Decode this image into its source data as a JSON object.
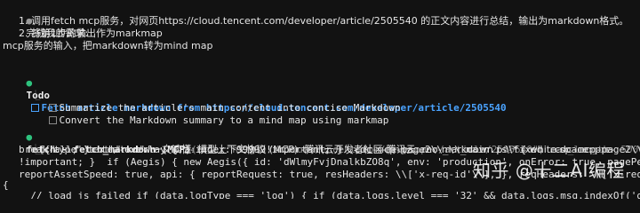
{
  "summary_block": {
    "bullet": "●",
    "title": "完成我的需求:",
    "steps": [
      "1. 调用fetch mcp服务，对网页https://cloud.tencent.com/developer/article/2505540 的正文内容进行总结，输出为markdown格式。",
      "2. 将第1步的输出作为markmap",
      "mcp服务的输入，把markdown转为mind map"
    ]
  },
  "todo_block": {
    "bullet": "●",
    "title": "Todo",
    "connector": "⎿",
    "items": [
      {
        "text": "Fetch article markdown from https://cloud.tencent.com/developer/article/2505540",
        "active": true
      },
      {
        "text": "Summarize the article's main content into concise Markdown",
        "active": false
      },
      {
        "text": "Convert the Markdown summary to a mind map using markmap",
        "active": false
      }
    ]
  },
  "fetch_block": {
    "bullet": "●",
    "call_name": "fetch - fetch_markdown (MCP)",
    "call_args": "(url: \"https://cloud.tencent.com/developer/article/2505540\", max_length: 50000)",
    "connector": "⎿",
    "output_lines": [
      "[{\"type\":\"text\",\"text\":\"一文读懂: 模型上下文协议 (MCP) -腾讯云开发者社区-腾讯云 .rno-markdown p \\\\* { white-space: pre-",
      "break-all; } .tea-overlay { z-index: 99999!important; } .cdc-mcp-page2\\\\_\\\\_main.is-fixed .cdc-mcp-page2\\\\_\\\\_toolbar {",
      "!important; }  if (Aegis) { new Aegis({ id: 'dWlmyFvjDnalkbZO8q', env: 'production', onError: true, pagePerformance: tr",
      "reportAssetSpeed: true, api: { reportRequest: true, resHeaders: \\\\['x-req-id'\\\\], }, reqHeaders: \\\\['x-req-id'\\\\], reques",
      "{",
      "  // load js failed if (data.logType === 'log') { if (data.logs.level === '32' && data.logs.msg.indexOf('google') > -1)"
    ]
  },
  "watermark": "知乎 @十二AI编程",
  "colors": {
    "background": "#121212",
    "text": "#d4d4d4",
    "active_item": "#4aa3ff",
    "bullet_green": "#2ec27e",
    "dim": "#8a8a8a"
  }
}
